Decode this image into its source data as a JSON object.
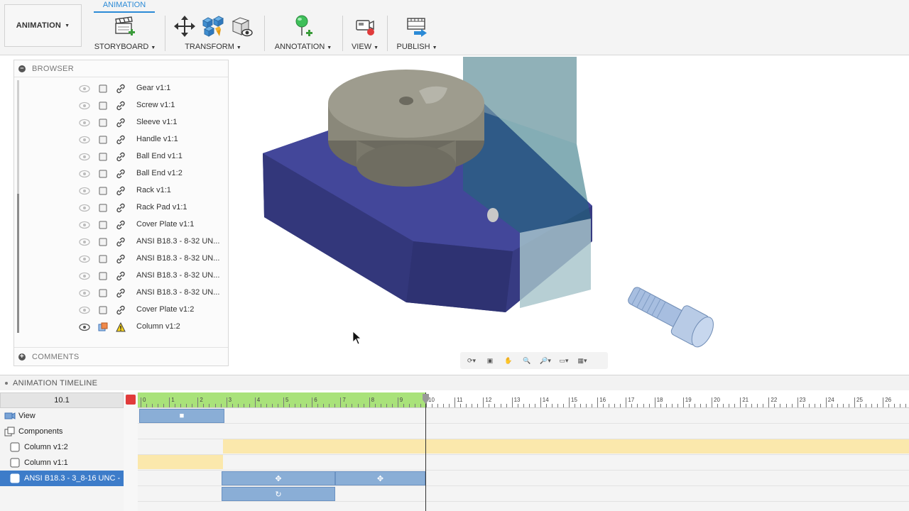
{
  "toolbar": {
    "workspace_label": "ANIMATION",
    "active_tab": "ANIMATION",
    "groups": [
      {
        "label": "STORYBOARD",
        "icons": [
          "storyboard-clapper-icon"
        ]
      },
      {
        "label": "TRANSFORM",
        "icons": [
          "move-arrows-icon",
          "explode-components-icon",
          "show-hide-icon"
        ]
      },
      {
        "label": "ANNOTATION",
        "icons": [
          "callout-pin-icon"
        ]
      },
      {
        "label": "VIEW",
        "icons": [
          "view-camera-record-icon"
        ]
      },
      {
        "label": "PUBLISH",
        "icons": [
          "publish-video-icon"
        ]
      }
    ]
  },
  "browser": {
    "title": "BROWSER",
    "footer": "COMMENTS",
    "items": [
      {
        "label": "Gear v1:1",
        "visible": false
      },
      {
        "label": "Screw v1:1",
        "visible": false
      },
      {
        "label": "Sleeve v1:1",
        "visible": false
      },
      {
        "label": "Handle v1:1",
        "visible": false
      },
      {
        "label": "Ball End v1:1",
        "visible": false
      },
      {
        "label": "Ball End v1:2",
        "visible": false
      },
      {
        "label": "Rack v1:1",
        "visible": false
      },
      {
        "label": "Rack Pad v1:1",
        "visible": false
      },
      {
        "label": "Cover Plate v1:1",
        "visible": false
      },
      {
        "label": "ANSI B18.3 - 8-32 UN...",
        "visible": false
      },
      {
        "label": "ANSI B18.3 - 8-32 UN...",
        "visible": false
      },
      {
        "label": "ANSI B18.3 - 8-32 UN...",
        "visible": false
      },
      {
        "label": "ANSI B18.3 - 8-32 UN...",
        "visible": false
      },
      {
        "label": "Cover Plate v1:2",
        "visible": false
      },
      {
        "label": "Column v1:2",
        "visible": true,
        "warning": true
      }
    ]
  },
  "timeline": {
    "title": "ANIMATION TIMELINE",
    "current_time": "10.1",
    "ruler_labels": [
      "0",
      "1",
      "2",
      "3",
      "4",
      "5",
      "6",
      "7",
      "8",
      "9",
      "10",
      "11",
      "12",
      "13",
      "14",
      "15",
      "16",
      "17",
      "18",
      "19",
      "20",
      "21",
      "22",
      "23",
      "24",
      "25",
      "26"
    ],
    "tracks": [
      {
        "label": "View"
      },
      {
        "label": "Components"
      },
      {
        "label": "Column v1:2"
      },
      {
        "label": "Column v1:1"
      },
      {
        "label": "ANSI B18.3 - 3_8-16 UNC -"
      }
    ]
  },
  "colors": {
    "accent": "#2b8ad6",
    "base_part": "#3b3f8c",
    "gear_part": "#8c8a7b",
    "timeline_green": "#a9e27a",
    "timeline_bar": "#8aaed6",
    "selected_track": "#3d7cc9"
  }
}
